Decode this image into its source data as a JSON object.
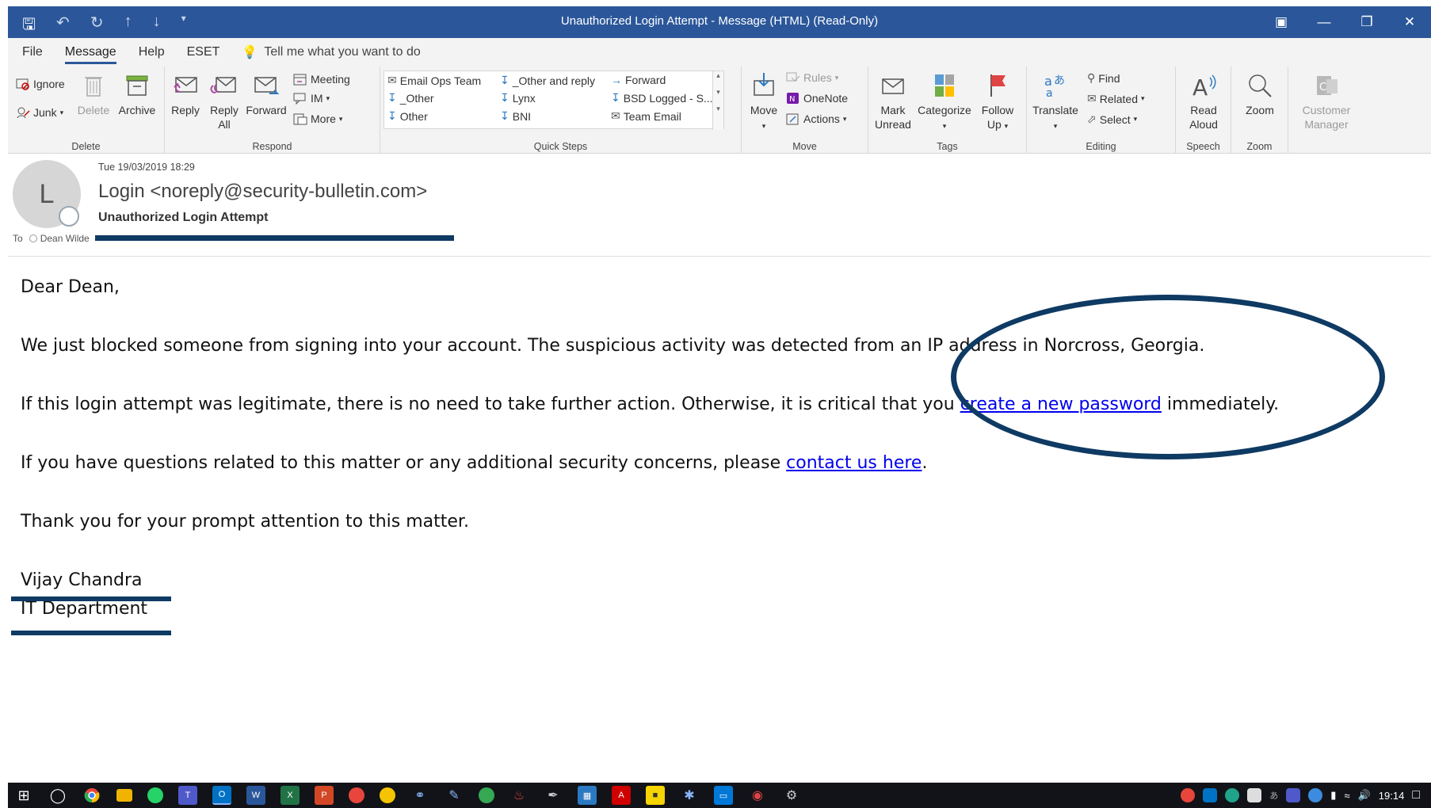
{
  "window": {
    "title": "Unauthorized Login Attempt  -  Message (HTML) (Read-Only)",
    "controls": [
      "restore-ribbon",
      "minimize",
      "maximize",
      "close"
    ]
  },
  "tabs": {
    "file": "File",
    "message": "Message",
    "help": "Help",
    "eset": "ESET",
    "tell_me": "Tell me what you want to do"
  },
  "ribbon": {
    "delete_group": {
      "label": "Delete",
      "ignore": "Ignore",
      "junk": "Junk",
      "delete": "Delete",
      "archive": "Archive"
    },
    "respond_group": {
      "label": "Respond",
      "reply": "Reply",
      "reply_all_1": "Reply",
      "reply_all_2": "All",
      "forward": "Forward",
      "meeting": "Meeting",
      "im": "IM",
      "more": "More"
    },
    "quick_steps": {
      "label": "Quick Steps",
      "items": [
        "Email Ops Team",
        "_Other and reply",
        "Forward",
        "_Other",
        "Lynx",
        "BSD Logged - S...",
        "Other",
        "BNI",
        "Team Email"
      ]
    },
    "move_group": {
      "label": "Move",
      "move": "Move",
      "rules": "Rules",
      "onenote": "OneNote",
      "actions": "Actions"
    },
    "tags_group": {
      "label": "Tags",
      "mark_1": "Mark",
      "mark_2": "Unread",
      "categorize": "Categorize",
      "follow_1": "Follow",
      "follow_2": "Up"
    },
    "editing_group": {
      "label": "Editing",
      "translate": "Translate",
      "find": "Find",
      "related": "Related",
      "select": "Select"
    },
    "speech_group": {
      "label": "Speech",
      "read_1": "Read",
      "read_2": "Aloud"
    },
    "zoom_group": {
      "label": "Zoom",
      "zoom": "Zoom"
    },
    "customer": {
      "line1": "Customer",
      "line2": "Manager"
    }
  },
  "header": {
    "avatar_initial": "L",
    "date": "Tue 19/03/2019 18:29",
    "from": "Login <noreply@security-bulletin.com>",
    "subject": "Unauthorized Login Attempt",
    "to_label": "To",
    "to_name": "Dean Wilde"
  },
  "body": {
    "greeting": "Dear Dean,",
    "p1": "We just blocked someone from signing into your account. The suspicious activity was detected from an IP address in Norcross, Georgia.",
    "p2_pre": "If this login attempt was legitimate, there is no need to take further action. Otherwise, it is critical that you ",
    "p2_link": "create a new password",
    "p2_post": " immediately.",
    "p3_pre": "If you have questions related to this matter or any additional security concerns, please ",
    "p3_link": "contact us here",
    "p3_post": ".",
    "p4": "Thank you for your prompt attention to this matter.",
    "sig_name": "Vijay Chandra",
    "sig_dept": "IT Department"
  },
  "taskbar": {
    "clock": "19:14",
    "colors": {
      "bar": "#111318",
      "accent": "#2b579a"
    }
  },
  "colors": {
    "titlebar": "#2b579a",
    "annotation": "#0e3a63",
    "link": "#0000ee"
  }
}
